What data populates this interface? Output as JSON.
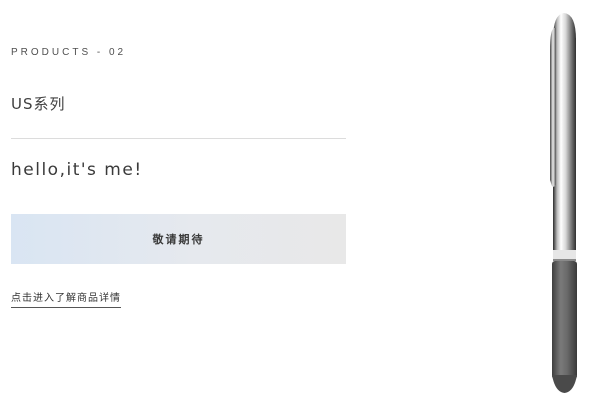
{
  "product": {
    "eyebrow": "PRODUCTS - 02",
    "series_title": "US系列",
    "tagline": "hello,it's me!",
    "cta_label": "敬请期待",
    "detail_link": "点击进入了解商品详情"
  },
  "colors": {
    "button_gradient_start": "#d9e5f3",
    "button_gradient_end": "#e8e8e8",
    "divider": "#dcdcdc",
    "pen_grip": "#6a6a6a"
  },
  "image": {
    "icon": "pen-product-image"
  }
}
